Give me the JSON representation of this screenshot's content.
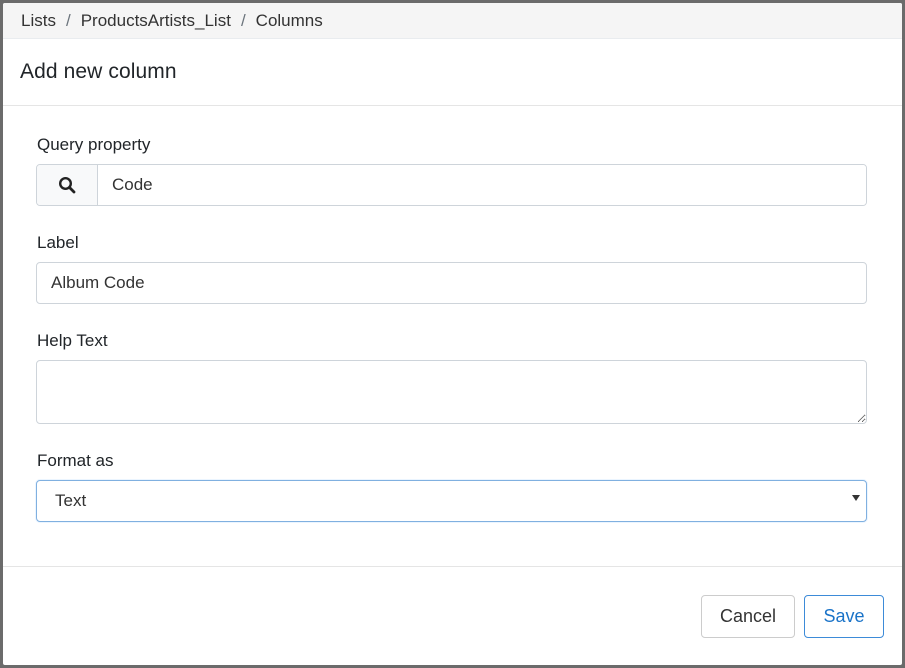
{
  "breadcrumb": {
    "items": [
      "Lists",
      "ProductsArtists_List",
      "Columns"
    ],
    "separator": "/"
  },
  "dialog": {
    "title": "Add new column"
  },
  "form": {
    "query_property": {
      "label": "Query property",
      "value": "Code",
      "icon": "search-icon"
    },
    "label_field": {
      "label": "Label",
      "value": "Album Code"
    },
    "help_text": {
      "label": "Help Text",
      "value": ""
    },
    "format_as": {
      "label": "Format as",
      "selected": "Text"
    }
  },
  "footer": {
    "cancel_label": "Cancel",
    "save_label": "Save"
  },
  "colors": {
    "primary": "#1a73c8",
    "border": "#ced4da",
    "breadcrumb_bg": "#f5f5f5"
  }
}
